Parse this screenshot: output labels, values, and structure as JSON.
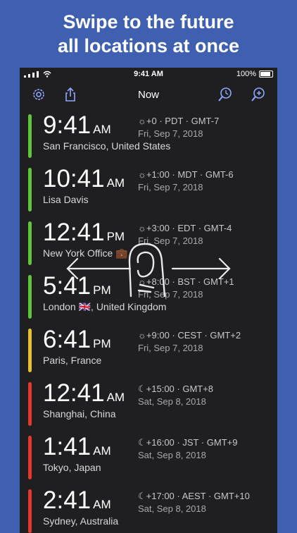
{
  "headline": {
    "line1": "Swipe to the future",
    "line2": "all locations at once"
  },
  "status_bar": {
    "time": "9:41 AM",
    "battery": "100%"
  },
  "nav": {
    "title": "Now",
    "settings_icon": "gear-icon",
    "share_icon": "share-icon",
    "time_search_icon": "clock-search-icon",
    "add_icon": "zoom-plus-icon"
  },
  "colors": {
    "green": "#5fc53a",
    "yellow": "#e6c12a",
    "red": "#e33a2d",
    "background": "#3f5fb0",
    "panel": "#1f1f21"
  },
  "locations": [
    {
      "time": "9:41",
      "ampm": "AM",
      "place": "San Francisco, United States",
      "offset": "☼+0 · PDT · GMT-7",
      "date": "Fri, Sep 7, 2018",
      "color": "green"
    },
    {
      "time": "10:41",
      "ampm": "AM",
      "place": "Lisa Davis",
      "offset": "☼+1:00 · MDT · GMT-6",
      "date": "Fri, Sep 7, 2018",
      "color": "green"
    },
    {
      "time": "12:41",
      "ampm": "PM",
      "place": "New York Office 💼",
      "offset": "☼+3:00 · EDT · GMT-4",
      "date": "Fri, Sep 7, 2018",
      "color": "green"
    },
    {
      "time": "5:41",
      "ampm": "PM",
      "place": "London 🇬🇧, United Kingdom",
      "offset": "☼+8:00 · BST · GMT+1",
      "date": "Fri, Sep 7, 2018",
      "color": "green"
    },
    {
      "time": "6:41",
      "ampm": "PM",
      "place": "Paris, France",
      "offset": "☼+9:00 · CEST · GMT+2",
      "date": "Fri, Sep 7, 2018",
      "color": "yellow"
    },
    {
      "time": "12:41",
      "ampm": "AM",
      "place": "Shanghai, China",
      "offset": "☾+15:00 · GMT+8",
      "date": "Sat, Sep 8, 2018",
      "color": "red"
    },
    {
      "time": "1:41",
      "ampm": "AM",
      "place": "Tokyo, Japan",
      "offset": "☾+16:00 · JST · GMT+9",
      "date": "Sat, Sep 8, 2018",
      "color": "red"
    },
    {
      "time": "2:41",
      "ampm": "AM",
      "place": "Sydney, Australia",
      "offset": "☾+17:00 · AEST · GMT+10",
      "date": "Sat, Sep 8, 2018",
      "color": "red"
    }
  ]
}
